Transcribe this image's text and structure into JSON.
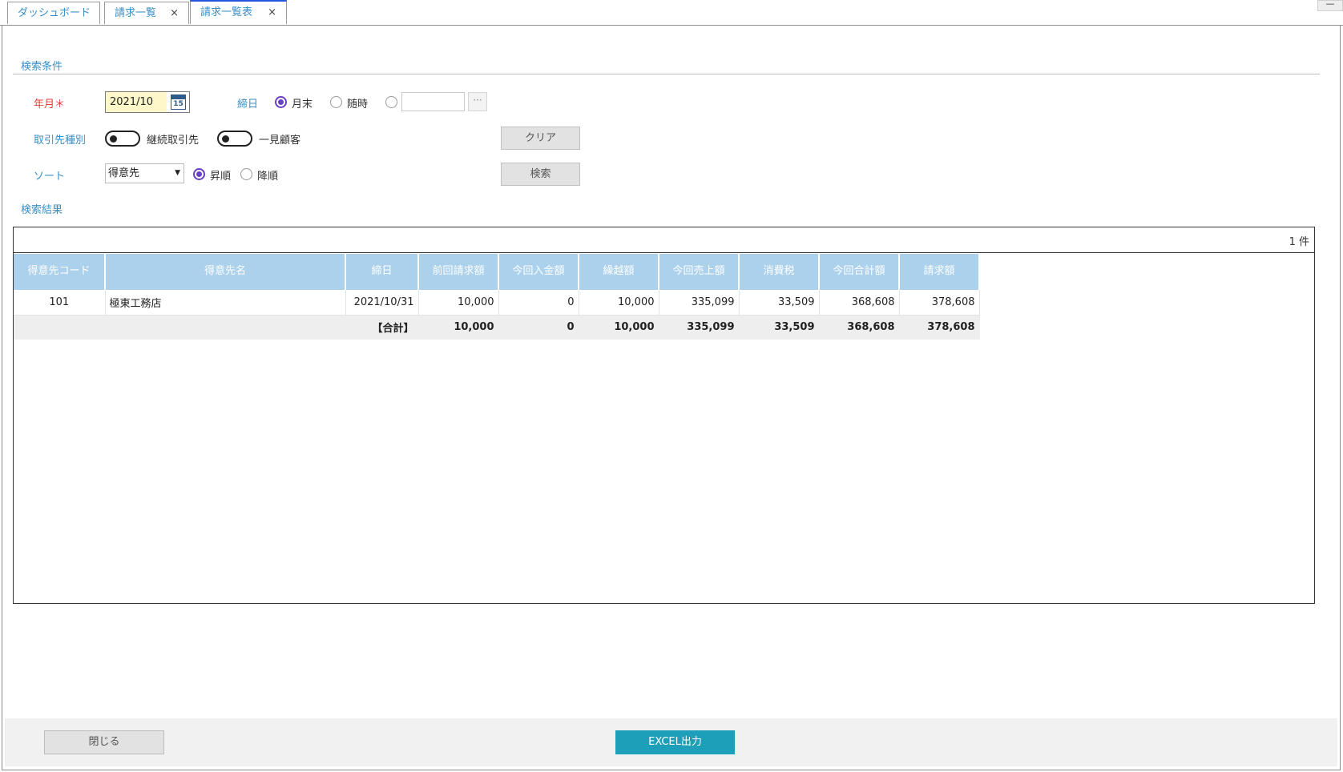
{
  "tabs": [
    {
      "label": "ダッシュボード",
      "closable": false,
      "active": false
    },
    {
      "label": "請求一覧",
      "closable": true,
      "active": false
    },
    {
      "label": "請求一覧表",
      "closable": true,
      "active": true
    }
  ],
  "tab_close_glyph": "×",
  "window": {
    "minimize_glyph": "—"
  },
  "search": {
    "section_title": "検索条件",
    "year_month_label": "年月＊",
    "year_month_value": "2021/10",
    "calendar_day": "15",
    "closing_label": "締日",
    "closing_options": [
      "月末",
      "随時"
    ],
    "closing_selected": "月末",
    "dots_label": "···",
    "partner_type_label": "取引先種別",
    "partner_toggles": [
      "継続取引先",
      "一見顧客"
    ],
    "clear_button": "クリア",
    "sort_label": "ソート",
    "sort_value": "得意先",
    "sort_options": [
      "昇順",
      "降順"
    ],
    "sort_selected": "昇順",
    "search_button": "検索"
  },
  "results": {
    "section_title": "検索結果",
    "count": "1 件",
    "columns": [
      "得意先コード",
      "得意先名",
      "締日",
      "前回請求額",
      "今回入金額",
      "繰越額",
      "今回売上額",
      "消費税",
      "今回合計額",
      "請求額"
    ],
    "rows": [
      [
        "101",
        "極東工務店",
        "2021/10/31",
        "10,000",
        "0",
        "10,000",
        "335,099",
        "33,509",
        "368,608",
        "378,608"
      ]
    ],
    "total": {
      "label": "【合計】",
      "values": [
        "10,000",
        "0",
        "10,000",
        "335,099",
        "33,509",
        "368,608",
        "378,608"
      ]
    }
  },
  "footer": {
    "close_button": "閉じる",
    "excel_button": "EXCEL出力"
  },
  "colors": {
    "accent": "#3a8fc7",
    "required": "#e23b3b",
    "radio": "#6a3fc0",
    "header_bg": "#acd1ec",
    "excel_button": "#1d9fb9"
  }
}
